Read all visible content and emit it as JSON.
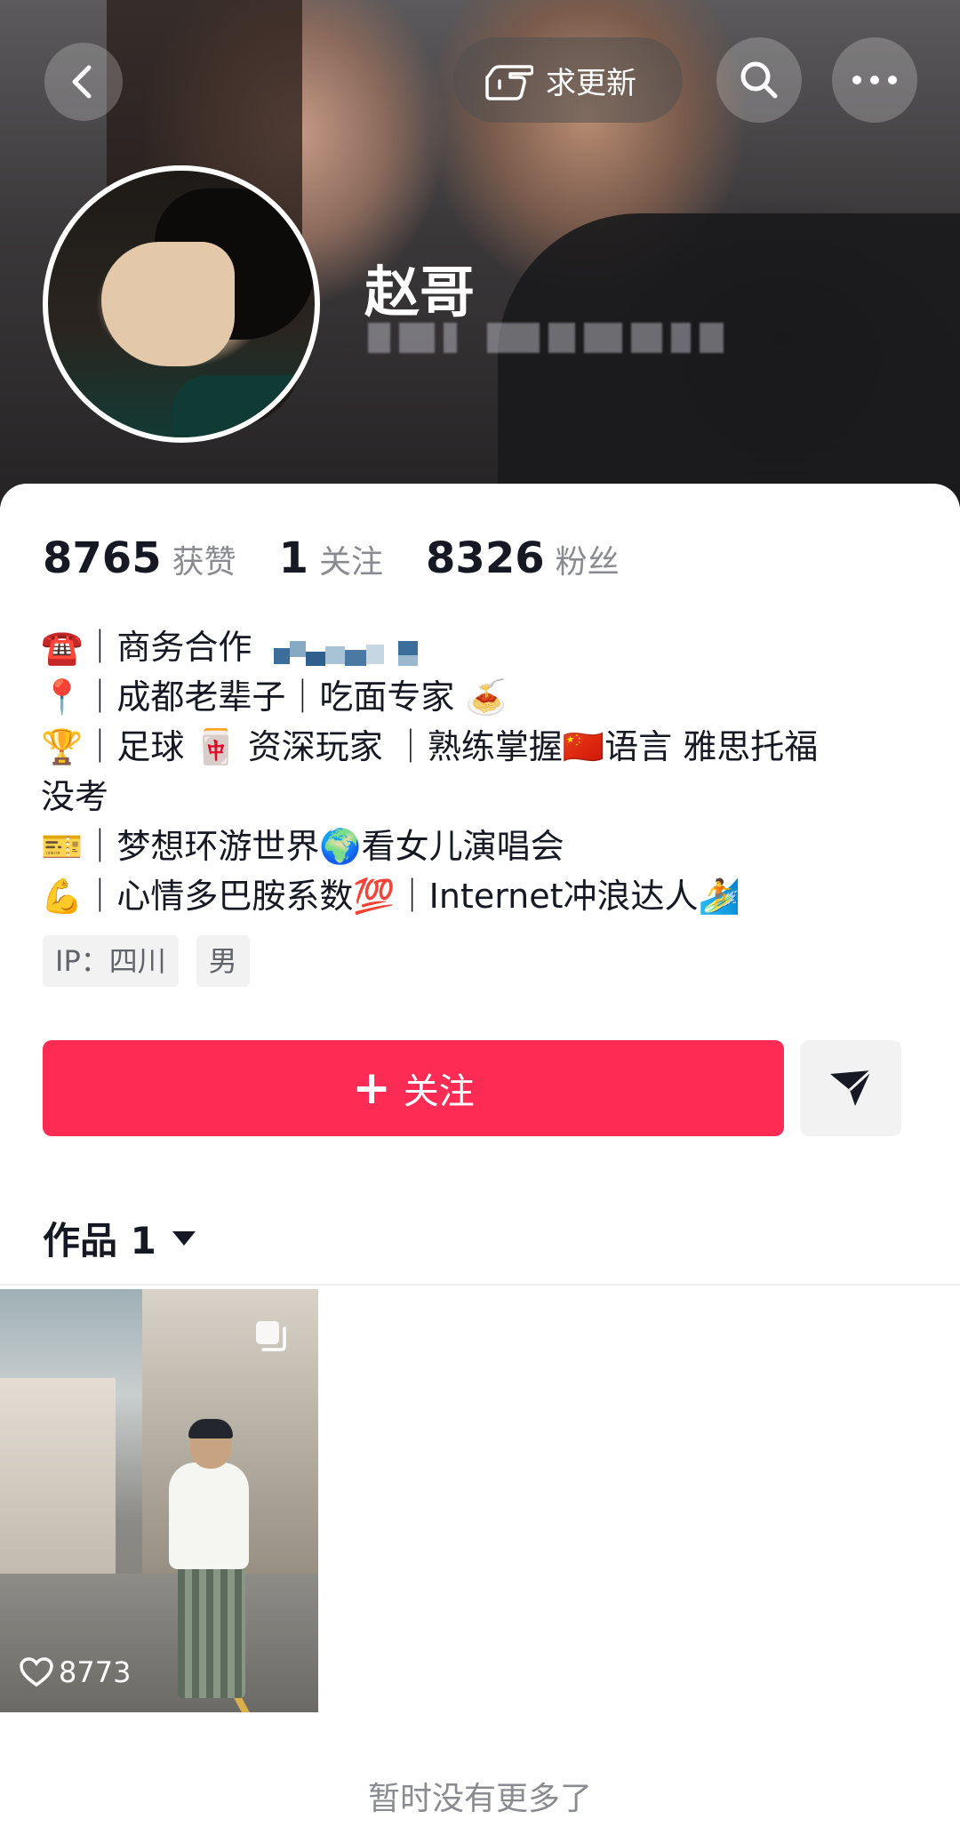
{
  "header": {
    "update_label": "求更新",
    "nickname": "赵哥"
  },
  "stats": [
    {
      "num": "8765",
      "label": "获赞"
    },
    {
      "num": "1",
      "label": "关注"
    },
    {
      "num": "8326",
      "label": "粉丝"
    }
  ],
  "bio": {
    "line1": "☎️｜商务合作",
    "line2": "📍｜成都老辈子｜吃面专家 🍝",
    "line3": "🏆｜足球 🀄 资深玩家 ｜熟练掌握🇨🇳语言 雅思托福",
    "line4": "没考",
    "line5": "🎫｜梦想环游世界🌍看女儿演唱会",
    "line6": "💪｜心情多巴胺系数💯｜Internet冲浪达人🏄"
  },
  "tags": {
    "ip": "IP：四川",
    "gender": "男"
  },
  "actions": {
    "follow_label": "关注"
  },
  "works": {
    "header": "作品 1",
    "items": [
      {
        "likes": "8773"
      }
    ]
  },
  "footer": {
    "end_note": "暂时没有更多了"
  },
  "colors": {
    "accent": "#fe2c55",
    "text_primary": "#161823",
    "text_secondary": "#8a8b91"
  }
}
